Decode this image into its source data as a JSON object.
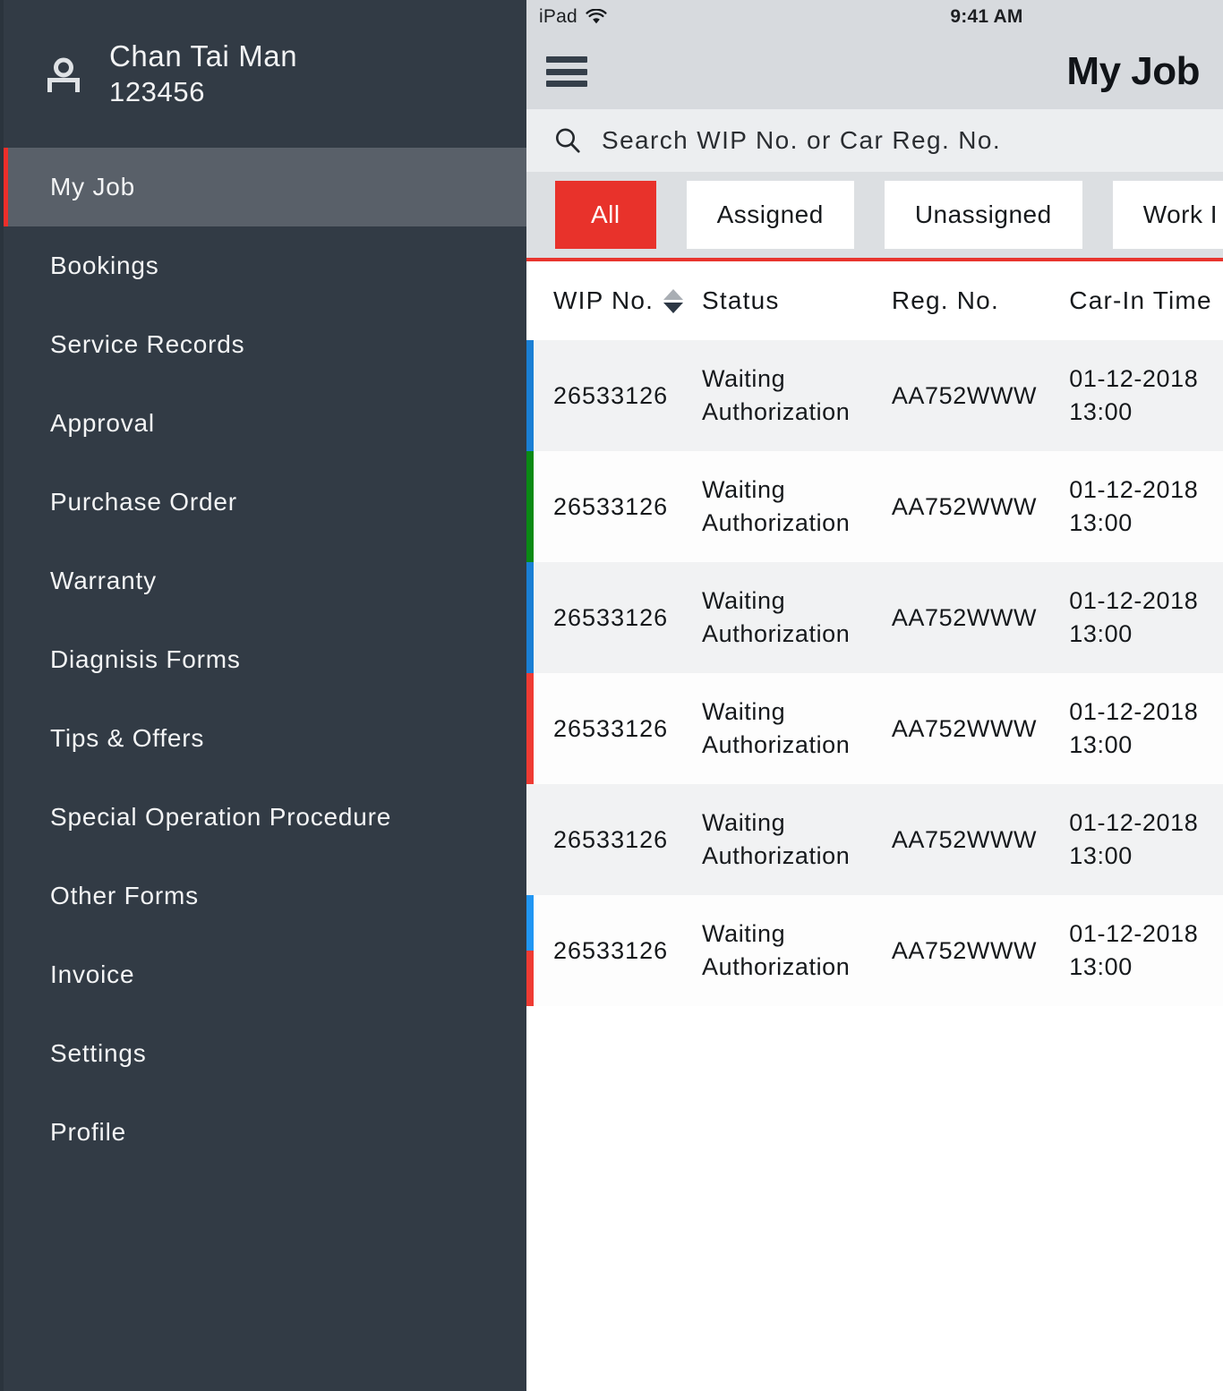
{
  "sidebar": {
    "profile": {
      "icon": "user-desk-icon",
      "name": "Chan Tai Man",
      "id": "123456"
    },
    "items": [
      {
        "label": "My Job",
        "active": true
      },
      {
        "label": "Bookings",
        "active": false
      },
      {
        "label": "Service Records",
        "active": false
      },
      {
        "label": "Approval",
        "active": false
      },
      {
        "label": "Purchase Order",
        "active": false
      },
      {
        "label": "Warranty",
        "active": false
      },
      {
        "label": "Diagnisis Forms",
        "active": false
      },
      {
        "label": "Tips & Offers",
        "active": false
      },
      {
        "label": "Special Operation Procedure",
        "active": false
      },
      {
        "label": "Other Forms",
        "active": false
      },
      {
        "label": "Invoice",
        "active": false
      },
      {
        "label": "Settings",
        "active": false
      },
      {
        "label": "Profile",
        "active": false
      }
    ],
    "accent_color": "#ed2f2a",
    "background_color": "#323b45",
    "active_background_color": "#596069"
  },
  "device": {
    "status_bar": {
      "device_name": "iPad",
      "wifi_icon": "wifi-icon",
      "time": "9:41 AM"
    },
    "nav_bar": {
      "menu_icon": "hamburger-menu-icon",
      "title": "My Job"
    },
    "search": {
      "icon": "search-icon",
      "placeholder": "Search WIP No. or Car Reg. No.",
      "value": ""
    },
    "filters": [
      {
        "label": "All",
        "active": true
      },
      {
        "label": "Assigned",
        "active": false
      },
      {
        "label": "Unassigned",
        "active": false
      },
      {
        "label": "Work I",
        "active": false
      }
    ],
    "table": {
      "columns": [
        {
          "key": "wip",
          "label": "WIP No.",
          "sortable": true,
          "sort_icon": "sort-updown-icon"
        },
        {
          "key": "status",
          "label": "Status",
          "sortable": false
        },
        {
          "key": "reg",
          "label": "Reg. No.",
          "sortable": false
        },
        {
          "key": "time",
          "label": "Car-In Time",
          "sortable": false
        }
      ],
      "rows": [
        {
          "wip": "26533126",
          "status": "Waiting\nAuthorization",
          "reg": "AA752WWW",
          "time": "01-12-2018\n13:00",
          "bars": [
            "#1a7fd4"
          ]
        },
        {
          "wip": "26533126",
          "status": "Waiting\nAuthorization",
          "reg": "AA752WWW",
          "time": "01-12-2018\n13:00",
          "bars": [
            "#0a8a14"
          ]
        },
        {
          "wip": "26533126",
          "status": "Waiting\nAuthorization",
          "reg": "AA752WWW",
          "time": "01-12-2018\n13:00",
          "bars": [
            "#1a7fd4"
          ]
        },
        {
          "wip": "26533126",
          "status": "Waiting\nAuthorization",
          "reg": "AA752WWW",
          "time": "01-12-2018\n13:00",
          "bars": [
            "#ef3b33"
          ]
        },
        {
          "wip": "26533126",
          "status": "Waiting\nAuthorization",
          "reg": "AA752WWW",
          "time": "01-12-2018\n13:00",
          "bars": []
        },
        {
          "wip": "26533126",
          "status": "Waiting\nAuthorization",
          "reg": "AA752WWW",
          "time": "01-12-2018\n13:00",
          "bars": [
            "#2196f3",
            "#ef3b33"
          ]
        }
      ]
    },
    "colors": {
      "accent_red": "#e8322b",
      "header_rule_red": "#e8352e",
      "status_bar_bg": "#d7dade",
      "search_bg": "#eceef0",
      "filter_bg": "#dcdfe2",
      "row_alt_bg": "#f1f2f3"
    }
  }
}
